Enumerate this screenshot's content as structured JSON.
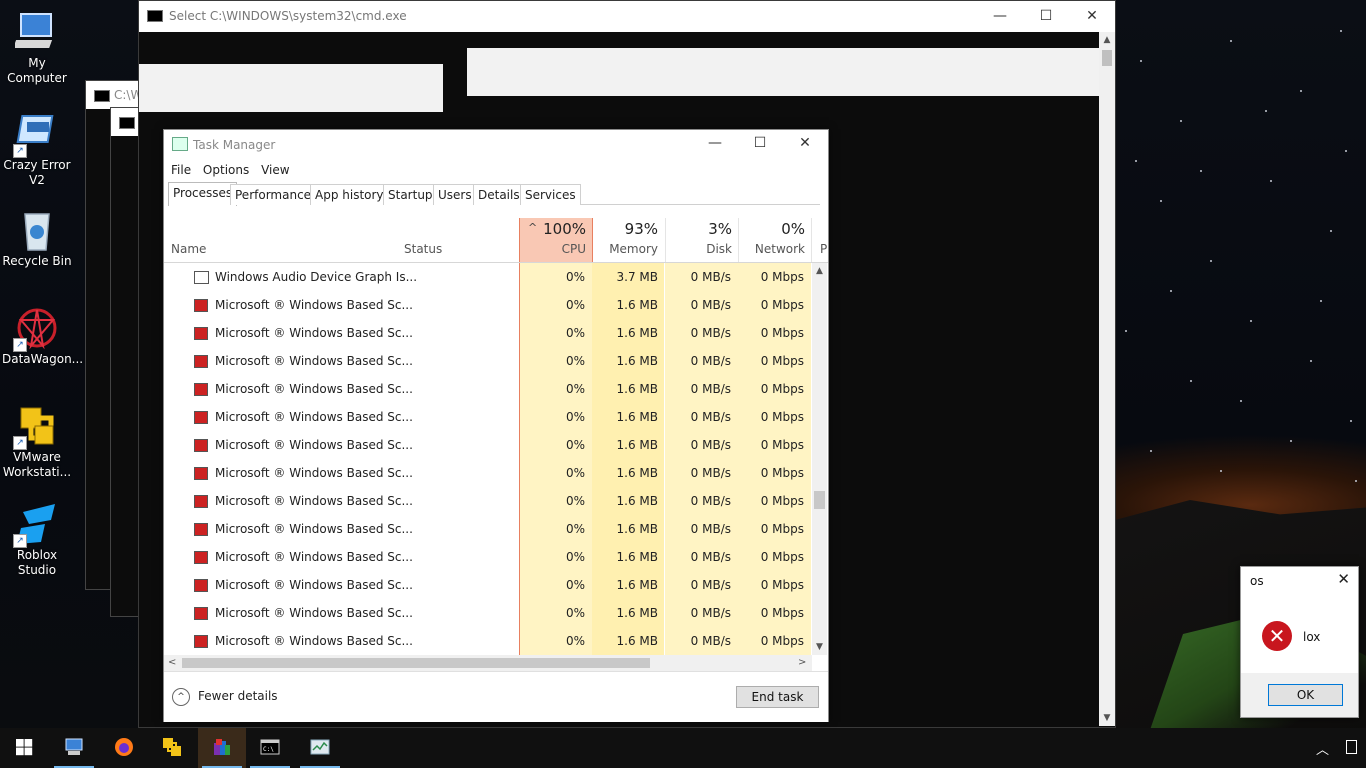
{
  "desktop_icons": [
    {
      "label": "My Computer",
      "icon": "computer-icon"
    },
    {
      "label": "Crazy Error V2",
      "icon": "error-app-icon"
    },
    {
      "label": "Recycle Bin",
      "icon": "recycle-bin-icon"
    },
    {
      "label": "DataWagon...",
      "icon": "datawagon-icon"
    },
    {
      "label": "VMware Workstati...",
      "icon": "vmware-icon"
    },
    {
      "label": "Roblox Studio",
      "icon": "roblox-studio-icon"
    }
  ],
  "cmd_window": {
    "title": "Select C:\\WINDOWS\\system32\\cmd.exe"
  },
  "cmd_back1": {
    "title": "C:\\W"
  },
  "task_manager": {
    "title": "Task Manager",
    "menu": [
      "File",
      "Options",
      "View"
    ],
    "tabs": [
      "Processes",
      "Performance",
      "App history",
      "Startup",
      "Users",
      "Details",
      "Services"
    ],
    "active_tab": "Processes",
    "columns": {
      "name": "Name",
      "status": "Status",
      "cpu": {
        "pct": "100%",
        "label": "CPU"
      },
      "memory": {
        "pct": "93%",
        "label": "Memory"
      },
      "disk": {
        "pct": "3%",
        "label": "Disk"
      },
      "network": {
        "pct": "0%",
        "label": "Network"
      },
      "power_trunc": "P"
    },
    "rows": [
      {
        "name": "Windows Audio Device Graph Is...",
        "cpu": "0%",
        "memory": "3.7 MB",
        "disk": "0 MB/s",
        "network": "0 Mbps",
        "icon": "service-icon"
      },
      {
        "name": "Microsoft ® Windows Based Sc...",
        "cpu": "0%",
        "memory": "1.6 MB",
        "disk": "0 MB/s",
        "network": "0 Mbps",
        "icon": "script-host-icon"
      },
      {
        "name": "Microsoft ® Windows Based Sc...",
        "cpu": "0%",
        "memory": "1.6 MB",
        "disk": "0 MB/s",
        "network": "0 Mbps",
        "icon": "script-host-icon"
      },
      {
        "name": "Microsoft ® Windows Based Sc...",
        "cpu": "0%",
        "memory": "1.6 MB",
        "disk": "0 MB/s",
        "network": "0 Mbps",
        "icon": "script-host-icon"
      },
      {
        "name": "Microsoft ® Windows Based Sc...",
        "cpu": "0%",
        "memory": "1.6 MB",
        "disk": "0 MB/s",
        "network": "0 Mbps",
        "icon": "script-host-icon"
      },
      {
        "name": "Microsoft ® Windows Based Sc...",
        "cpu": "0%",
        "memory": "1.6 MB",
        "disk": "0 MB/s",
        "network": "0 Mbps",
        "icon": "script-host-icon"
      },
      {
        "name": "Microsoft ® Windows Based Sc...",
        "cpu": "0%",
        "memory": "1.6 MB",
        "disk": "0 MB/s",
        "network": "0 Mbps",
        "icon": "script-host-icon"
      },
      {
        "name": "Microsoft ® Windows Based Sc...",
        "cpu": "0%",
        "memory": "1.6 MB",
        "disk": "0 MB/s",
        "network": "0 Mbps",
        "icon": "script-host-icon"
      },
      {
        "name": "Microsoft ® Windows Based Sc...",
        "cpu": "0%",
        "memory": "1.6 MB",
        "disk": "0 MB/s",
        "network": "0 Mbps",
        "icon": "script-host-icon"
      },
      {
        "name": "Microsoft ® Windows Based Sc...",
        "cpu": "0%",
        "memory": "1.6 MB",
        "disk": "0 MB/s",
        "network": "0 Mbps",
        "icon": "script-host-icon"
      },
      {
        "name": "Microsoft ® Windows Based Sc...",
        "cpu": "0%",
        "memory": "1.6 MB",
        "disk": "0 MB/s",
        "network": "0 Mbps",
        "icon": "script-host-icon"
      },
      {
        "name": "Microsoft ® Windows Based Sc...",
        "cpu": "0%",
        "memory": "1.6 MB",
        "disk": "0 MB/s",
        "network": "0 Mbps",
        "icon": "script-host-icon"
      },
      {
        "name": "Microsoft ® Windows Based Sc...",
        "cpu": "0%",
        "memory": "1.6 MB",
        "disk": "0 MB/s",
        "network": "0 Mbps",
        "icon": "script-host-icon"
      },
      {
        "name": "Microsoft ® Windows Based Sc...",
        "cpu": "0%",
        "memory": "1.6 MB",
        "disk": "0 MB/s",
        "network": "0 Mbps",
        "icon": "script-host-icon"
      }
    ],
    "footer": {
      "fewer_details": "Fewer details",
      "end_task": "End task"
    },
    "colors": {
      "cpu_header": "#f9c8b4",
      "cpu_col": "#fff4c4",
      "mem_col": "#fff0b0",
      "cpu_border": "#e88060"
    }
  },
  "dialog": {
    "title": "os",
    "message": "lox",
    "ok": "OK",
    "icon": "error-icon"
  },
  "taskbar": {
    "items": [
      "start-icon",
      "computer-icon",
      "firefox-icon",
      "vmware-icon",
      "winrar-icon",
      "cmd-icon",
      "task-manager-icon"
    ],
    "active_item": "winrar-icon",
    "tray": [
      "chevron-up-icon",
      "notifications-icon"
    ]
  }
}
